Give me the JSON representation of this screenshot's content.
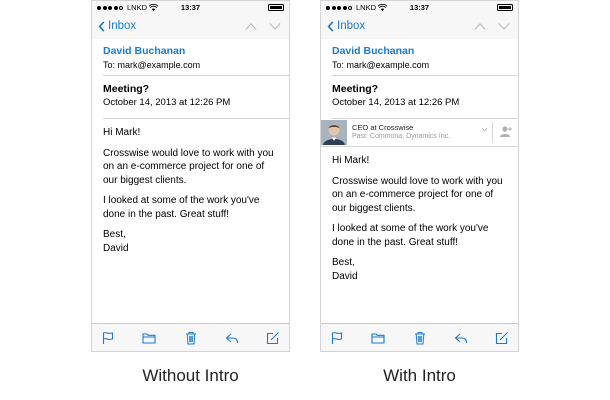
{
  "status_bar": {
    "carrier": "LNKD",
    "time": "13:37",
    "battery": "",
    "battery_level": 1.0
  },
  "nav": {
    "back_label": "Inbox"
  },
  "email": {
    "sender": "David Buchanan",
    "to": "To: mark@example.com",
    "subject": "Meeting?",
    "date": "October 14, 2013 at 12:26 PM",
    "greeting": "Hi Mark!",
    "paragraph1": "Crosswise would love to work with you on an e-commerce project for one of our biggest clients.",
    "paragraph2": "I looked at some of the work you've done in the past. Great stuff!",
    "signoff": "Best,",
    "signature": "David"
  },
  "intro": {
    "title": "CEO at Crosswise",
    "past": "Past: Commona, Dynamics Inc."
  },
  "captions": {
    "left": "Without Intro",
    "right": "With Intro"
  },
  "colors": {
    "accent": "#1a7bd6",
    "divider": "#d6d6d9",
    "bar_bg": "#f7f7f8"
  },
  "icons": {
    "back": "chevron-left-icon",
    "prev": "chevron-up-icon",
    "next": "chevron-down-icon",
    "toolbar": [
      "flag-icon",
      "folder-icon",
      "trash-icon",
      "reply-icon",
      "compose-icon"
    ]
  }
}
